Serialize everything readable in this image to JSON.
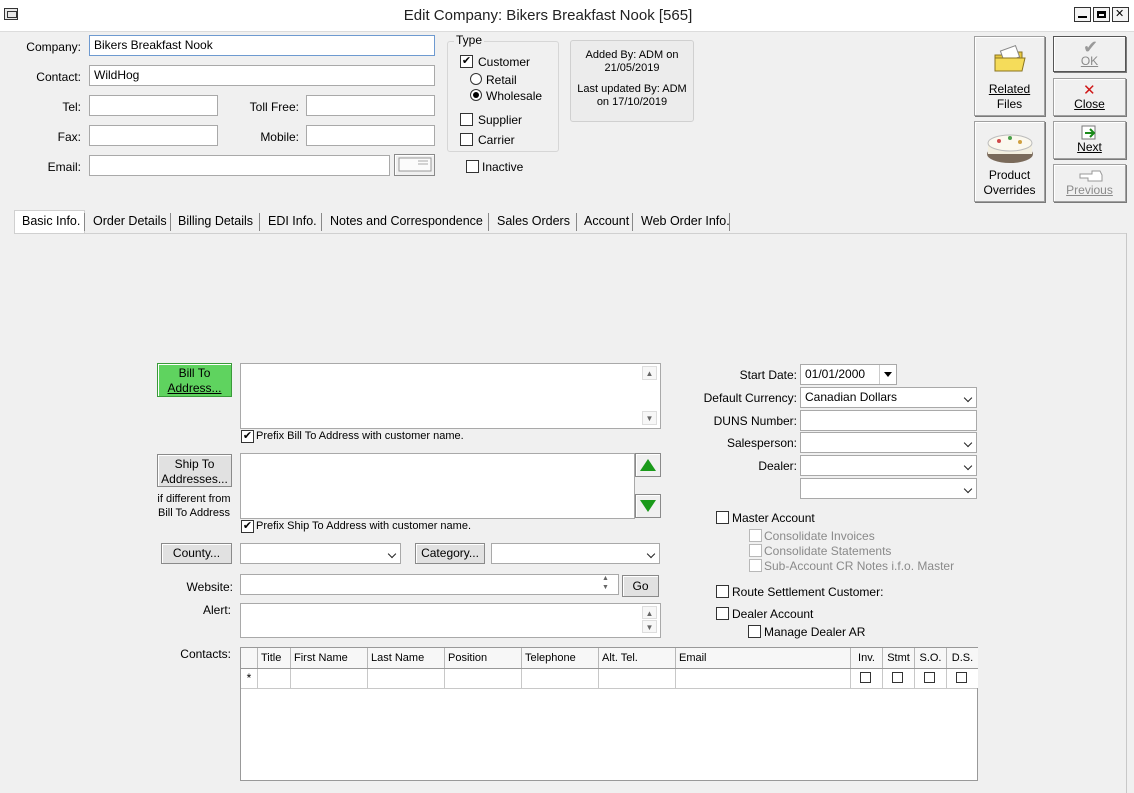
{
  "window": {
    "title": "Edit Company: Bikers Breakfast Nook [565]"
  },
  "header": {
    "company_label": "Company:",
    "company_value": "Bikers Breakfast Nook",
    "contact_label": "Contact:",
    "contact_value": "WildHog",
    "tel_label": "Tel:",
    "tel_value": "",
    "tollfree_label": "Toll Free:",
    "tollfree_value": "",
    "fax_label": "Fax:",
    "fax_value": "",
    "mobile_label": "Mobile:",
    "mobile_value": "",
    "email_label": "Email:",
    "email_value": ""
  },
  "type": {
    "label": "Type",
    "customer": "Customer",
    "retail": "Retail",
    "wholesale": "Wholesale",
    "supplier": "Supplier",
    "carrier": "Carrier",
    "inactive": "Inactive",
    "customer_checked": true,
    "wholesale_selected": true
  },
  "audit": {
    "added_line1": "Added By: ADM on",
    "added_line2": "21/05/2019",
    "updated_line1": "Last updated By: ADM",
    "updated_line2": "on 17/10/2019"
  },
  "actions": {
    "related_files_1": "Related",
    "related_files_2": "Files",
    "product_overrides_1": "Product",
    "product_overrides_2": "Overrides",
    "ok": "OK",
    "close": "Close",
    "next": "Next",
    "previous": "Previous"
  },
  "tabs": [
    {
      "label": "Basic Info."
    },
    {
      "label": "Order Details"
    },
    {
      "label": "Billing Details"
    },
    {
      "label": "EDI Info."
    },
    {
      "label": "Notes and Correspondence"
    },
    {
      "label": "Sales Orders"
    },
    {
      "label": "Account"
    },
    {
      "label": "Web Order Info."
    }
  ],
  "basic": {
    "bill_to_1": "Bill To",
    "bill_to_2": "Address...",
    "prefix_bill": "Prefix Bill To Address with customer name.",
    "ship_to_1": "Ship To",
    "ship_to_2": "Addresses...",
    "ship_note_1": "if different from",
    "ship_note_2": "Bill To Address",
    "prefix_ship": "Prefix Ship To Address with customer name.",
    "county": "County...",
    "category": "Category...",
    "website_label": "Website:",
    "go": "Go",
    "alert_label": "Alert:",
    "contacts_label": "Contacts:",
    "start_date_label": "Start Date:",
    "start_date_value": "01/01/2000",
    "currency_label": "Default Currency:",
    "currency_value": "Canadian Dollars",
    "duns_label": "DUNS Number:",
    "salesperson_label": "Salesperson:",
    "dealer_label": "Dealer:",
    "master_account": "Master Account",
    "consolidate_invoices": "Consolidate Invoices",
    "consolidate_statements": "Consolidate Statements",
    "subaccount_cr": "Sub-Account CR Notes i.f.o. Master",
    "route_settlement": "Route Settlement Customer:",
    "dealer_account": "Dealer Account",
    "manage_dealer_ar": "Manage Dealer AR"
  },
  "contacts_grid": {
    "columns": [
      "Title",
      "First Name",
      "Last Name",
      "Position",
      "Telephone",
      "Alt. Tel.",
      "Email",
      "Inv.",
      "Stmt",
      "S.O.",
      "D.S."
    ],
    "new_row_marker": "*"
  },
  "colors": {
    "bill_to_button": "#5fd35f",
    "field_border": "#a9a9a9",
    "focus_border": "#6e9ad0"
  }
}
